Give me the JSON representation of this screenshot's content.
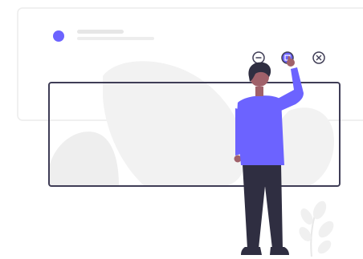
{
  "illustration": {
    "subject": "person-pressing-window-control-button",
    "colors": {
      "accent": "#6c63ff",
      "skin": "#a0616a",
      "hair": "#2f2e41",
      "pants": "#2f2e41",
      "outline": "#3f3d56",
      "card_border": "#e6e6e6",
      "background_shape": "#f2f2f2",
      "placeholder_line": "#e6e6e6",
      "plant": "#f2f2f2"
    },
    "controls": [
      {
        "icon": "minimize-icon",
        "state": "idle"
      },
      {
        "icon": "maximize-icon",
        "state": "pressed"
      },
      {
        "icon": "close-icon",
        "state": "idle"
      }
    ]
  }
}
